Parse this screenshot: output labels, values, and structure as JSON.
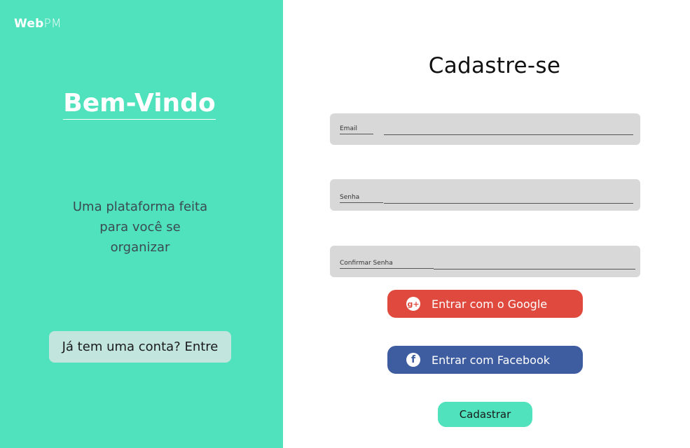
{
  "brand": {
    "bold": "Web",
    "light": "PM"
  },
  "left": {
    "welcome": "Bem-Vindo",
    "tagline": [
      "Uma plataforma feita",
      "para você se",
      "organizar"
    ],
    "login_button": "Já tem uma conta? Entre"
  },
  "form": {
    "title": "Cadastre-se",
    "email_label": "Email",
    "password_label": "Senha",
    "confirm_label": "Confirmar Senha",
    "google_button": "Entrar com o Google",
    "facebook_button": "Entrar com Facebook",
    "submit_button": "Cadastrar"
  },
  "colors": {
    "accent": "#4fe2bc",
    "google": "#e04a3e",
    "facebook": "#3e5ca0",
    "field": "#d8d8d8"
  },
  "icons": {
    "google": "google-plus-icon",
    "facebook": "facebook-icon"
  }
}
